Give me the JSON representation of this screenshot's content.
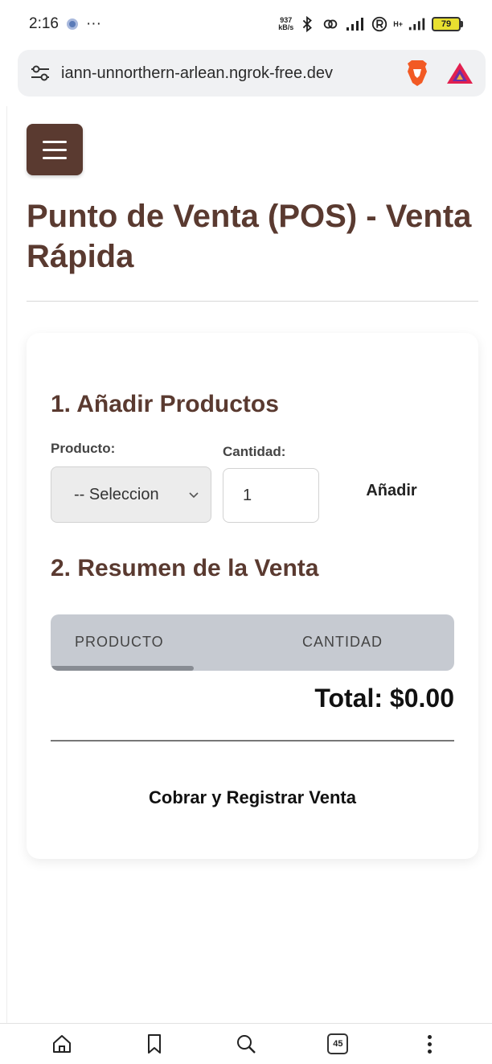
{
  "status_bar": {
    "time": "2:16",
    "ellipsis": "···",
    "net_speed_value": "937",
    "net_speed_unit": "kB/s",
    "network_type": "H+",
    "battery": "79"
  },
  "browser": {
    "url": "iann-unnorthern-arlean.ngrok-free.dev",
    "tabs_count": "45"
  },
  "page": {
    "title": "Punto de Venta (POS) - Venta Rápida",
    "section_add_title": "1. Añadir Productos",
    "product_label": "Producto:",
    "product_select_value": "-- Seleccion",
    "quantity_label": "Cantidad:",
    "quantity_value": "1",
    "add_button": "Añadir",
    "section_summary_title": "2. Resumen de la Venta",
    "table_headers": [
      "PRODUCTO",
      "CANTIDAD"
    ],
    "total": "Total: $0.00",
    "charge_button": "Cobrar y Registrar Venta"
  },
  "colors": {
    "brand": "#5a3a30",
    "table_header_bg": "#c6cad1"
  },
  "icons": [
    "tune-icon",
    "brave-lion-icon",
    "brave-rewards-icon",
    "menu-icon",
    "chevron-down-icon",
    "home-icon",
    "bookmark-icon",
    "search-icon",
    "tabs-icon",
    "more-icon"
  ]
}
